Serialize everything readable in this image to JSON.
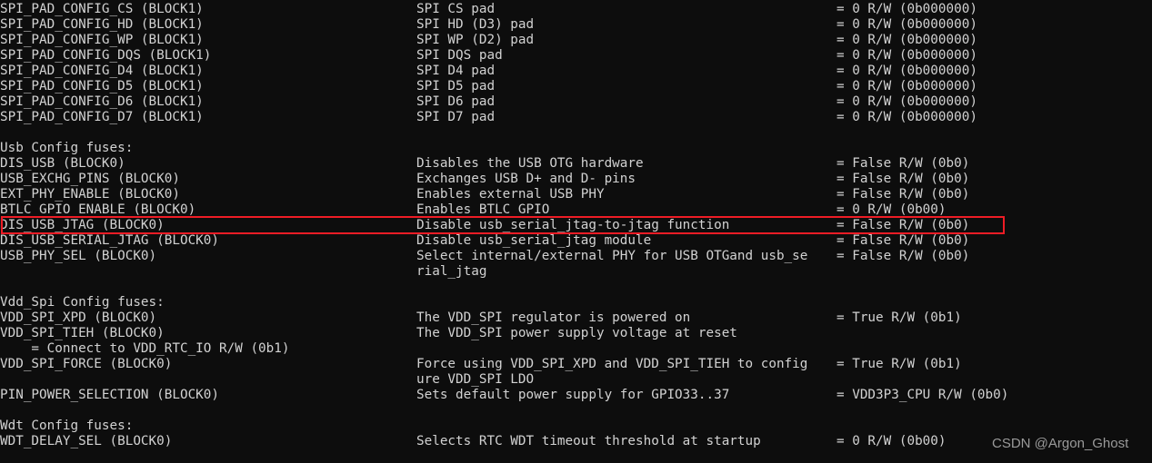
{
  "terminal": {
    "background": "#0d0d0d",
    "foreground": "#d2d2d2",
    "highlight_color": "#ee1c25",
    "watermark": "CSDN @Argon_Ghost"
  },
  "lines": [
    {
      "name": "SPI_PAD_CONFIG_CS (BLOCK1)",
      "desc": "SPI CS pad",
      "value": "= 0 R/W (0b000000)"
    },
    {
      "name": "SPI_PAD_CONFIG_HD (BLOCK1)",
      "desc": "SPI HD (D3) pad",
      "value": "= 0 R/W (0b000000)"
    },
    {
      "name": "SPI_PAD_CONFIG_WP (BLOCK1)",
      "desc": "SPI WP (D2) pad",
      "value": "= 0 R/W (0b000000)"
    },
    {
      "name": "SPI_PAD_CONFIG_DQS (BLOCK1)",
      "desc": "SPI DQS pad",
      "value": "= 0 R/W (0b000000)"
    },
    {
      "name": "SPI_PAD_CONFIG_D4 (BLOCK1)",
      "desc": "SPI D4 pad",
      "value": "= 0 R/W (0b000000)"
    },
    {
      "name": "SPI_PAD_CONFIG_D5 (BLOCK1)",
      "desc": "SPI D5 pad",
      "value": "= 0 R/W (0b000000)"
    },
    {
      "name": "SPI_PAD_CONFIG_D6 (BLOCK1)",
      "desc": "SPI D6 pad",
      "value": "= 0 R/W (0b000000)"
    },
    {
      "name": "SPI_PAD_CONFIG_D7 (BLOCK1)",
      "desc": "SPI D7 pad",
      "value": "= 0 R/W (0b000000)"
    },
    {
      "name": "",
      "desc": "",
      "value": ""
    },
    {
      "name": "Usb Config fuses:",
      "desc": "",
      "value": "",
      "header": true
    },
    {
      "name": "DIS_USB (BLOCK0)",
      "desc": "Disables the USB OTG hardware",
      "value": "= False R/W (0b0)"
    },
    {
      "name": "USB_EXCHG_PINS (BLOCK0)",
      "desc": "Exchanges USB D+ and D- pins",
      "value": "= False R/W (0b0)"
    },
    {
      "name": "EXT_PHY_ENABLE (BLOCK0)",
      "desc": "Enables external USB PHY",
      "value": "= False R/W (0b0)"
    },
    {
      "name": "BTLC_GPIO_ENABLE (BLOCK0)",
      "desc": "Enables BTLC GPIO",
      "value": "= 0 R/W (0b00)"
    },
    {
      "name": "DIS_USB_JTAG (BLOCK0)",
      "desc": "Disable usb_serial_jtag-to-jtag function",
      "value": "= False R/W (0b0)",
      "highlighted": true
    },
    {
      "name": "DIS_USB_SERIAL_JTAG (BLOCK0)",
      "desc": "Disable usb_serial_jtag module",
      "value": "= False R/W (0b0)"
    },
    {
      "name": "USB_PHY_SEL (BLOCK0)",
      "desc": "Select internal/external PHY for USB OTGand usb_se",
      "value": "= False R/W (0b0)"
    },
    {
      "name": "",
      "desc": "rial_jtag",
      "value": ""
    },
    {
      "name": "",
      "desc": "",
      "value": ""
    },
    {
      "name": "Vdd_Spi Config fuses:",
      "desc": "",
      "value": "",
      "header": true
    },
    {
      "name": "VDD_SPI_XPD (BLOCK0)",
      "desc": "The VDD_SPI regulator is powered on",
      "value": "= True R/W (0b1)"
    },
    {
      "name": "VDD_SPI_TIEH (BLOCK0)",
      "desc": "The VDD_SPI power supply voltage at reset",
      "value": ""
    },
    {
      "name": "    = Connect to VDD_RTC_IO R/W (0b1)",
      "desc": "",
      "value": "",
      "continuation": true
    },
    {
      "name": "VDD_SPI_FORCE (BLOCK0)",
      "desc": "Force using VDD_SPI_XPD and VDD_SPI_TIEH to config",
      "value": "= True R/W (0b1)"
    },
    {
      "name": "",
      "desc": "ure VDD_SPI LDO",
      "value": ""
    },
    {
      "name": "PIN_POWER_SELECTION (BLOCK0)",
      "desc": "Sets default power supply for GPIO33..37",
      "value": "= VDD3P3_CPU R/W (0b0)"
    },
    {
      "name": "",
      "desc": "",
      "value": ""
    },
    {
      "name": "Wdt Config fuses:",
      "desc": "",
      "value": "",
      "header": true
    },
    {
      "name": "WDT_DELAY_SEL (BLOCK0)",
      "desc": "Selects RTC WDT timeout threshold at startup",
      "value": "= 0 R/W (0b00)"
    }
  ]
}
